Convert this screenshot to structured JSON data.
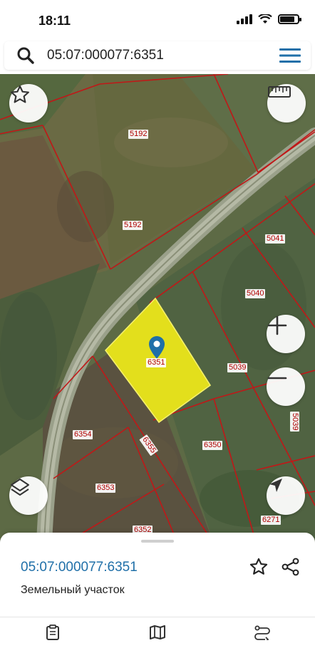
{
  "status_bar": {
    "time": "18:11"
  },
  "search": {
    "value": "05:07:000077:6351"
  },
  "map": {
    "parcels": {
      "p5192_top": "5192",
      "p5192_mid": "5192",
      "p5041": "5041",
      "p5040": "5040",
      "p5039": "5039",
      "p6351": "6351",
      "p6354": "6354",
      "p6355": "6355",
      "p6350": "6350",
      "p6353": "6353",
      "p6352": "6352",
      "p6271": "6271",
      "p5039_edge": "5039"
    }
  },
  "card": {
    "parcel_number": "05:07:000077:6351",
    "parcel_type": "Земельный участок"
  },
  "colors": {
    "accent": "#1f6fa8",
    "parcel_fill": "#e3df1c",
    "boundary": "#c01818"
  },
  "icons": {
    "search": "search-icon",
    "menu": "hamburger-menu-icon",
    "favorite": "star-icon",
    "ruler": "ruler-icon",
    "zoom_in": "plus-icon",
    "zoom_out": "minus-icon",
    "layers": "layers-icon",
    "location": "navigation-arrow-icon",
    "share": "share-icon",
    "nav_list": "clipboard-icon",
    "nav_map": "map-icon",
    "nav_routes": "route-icon"
  }
}
